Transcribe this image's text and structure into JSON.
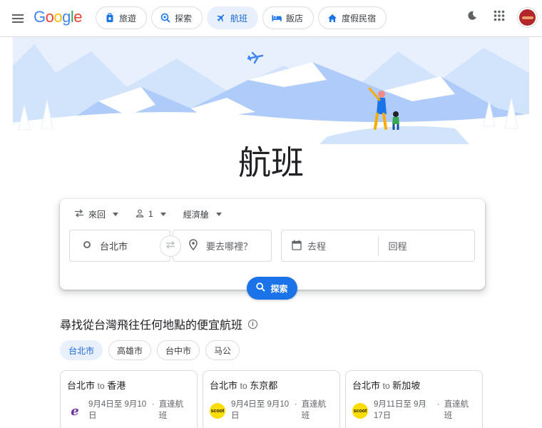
{
  "header": {
    "logo": "Google",
    "nav": [
      {
        "label": "旅遊",
        "icon": "suitcase-icon",
        "active": false
      },
      {
        "label": "探索",
        "icon": "explore-icon",
        "active": false
      },
      {
        "label": "航班",
        "icon": "airplane-icon",
        "active": true
      },
      {
        "label": "飯店",
        "icon": "bed-icon",
        "active": false
      },
      {
        "label": "度假民宿",
        "icon": "home-icon",
        "active": false
      }
    ]
  },
  "page_title": "航班",
  "search": {
    "trip_type": "來回",
    "passengers": "1",
    "cabin_class": "經濟艙",
    "origin": "台北市",
    "destination_placeholder": "要去哪裡？",
    "depart_placeholder": "去程",
    "return_placeholder": "回程",
    "search_label": "探索"
  },
  "section": {
    "title": "尋找從台灣飛往任何地點的便宜航班",
    "info_glyph": "i",
    "city_tabs": [
      {
        "label": "台北市",
        "active": true
      },
      {
        "label": "高雄市",
        "active": false
      },
      {
        "label": "台中市",
        "active": false
      },
      {
        "label": "马公",
        "active": false
      }
    ],
    "destinations": [
      {
        "from": "台北市",
        "to_word": "to",
        "to": "香港",
        "dates": "9月4日至 9月10日",
        "flight_type": "直達航班",
        "airline_icon": "eva-air-logo-icon",
        "airline_mark": "e"
      },
      {
        "from": "台北市",
        "to_word": "to",
        "to": "东京都",
        "dates": "9月4日至 9月10日",
        "flight_type": "直達航班",
        "airline_icon": "scoot-logo-icon",
        "airline_mark": "scoot"
      },
      {
        "from": "台北市",
        "to_word": "to",
        "to": "新加坡",
        "dates": "9月11日至 9月17日",
        "flight_type": "直達航班",
        "airline_icon": "scoot-logo-icon",
        "airline_mark": "scoot"
      }
    ]
  },
  "colors": {
    "accent": "#1a73e8",
    "active_chip_bg": "#e8f0fe",
    "hero_mountain": "#aecbfa",
    "avatar": "#b3262a"
  }
}
